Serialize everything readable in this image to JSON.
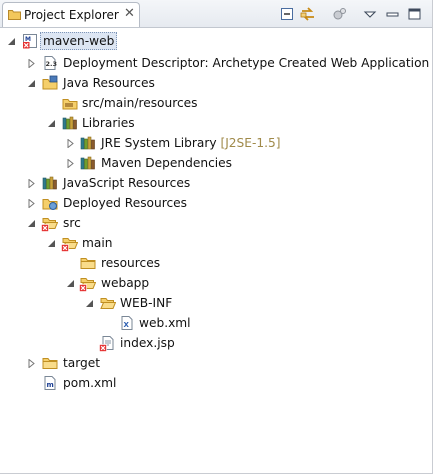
{
  "view": {
    "title": "Project Explorer",
    "close_glyph": "✕"
  },
  "toolbar": {
    "collapse_all_icon": "collapse-all-icon",
    "link_editor_icon": "link-with-editor-icon",
    "view_menu_icon": "view-menu-icon",
    "minimize_icon": "minimize-icon",
    "maximize_icon": "maximize-icon"
  },
  "tree": {
    "project": "maven-web",
    "deployment_descriptor": "Deployment Descriptor: Archetype Created Web Application",
    "java_resources": "Java Resources",
    "src_main_resources": "src/main/resources",
    "libraries": "Libraries",
    "jre_library": "JRE System Library",
    "jre_decoration": "[J2SE-1.5]",
    "maven_dependencies": "Maven Dependencies",
    "javascript_resources": "JavaScript Resources",
    "deployed_resources": "Deployed Resources",
    "src": "src",
    "main": "main",
    "resources": "resources",
    "webapp": "webapp",
    "web_inf": "WEB-INF",
    "web_xml": "web.xml",
    "index_jsp": "index.jsp",
    "target": "target",
    "pom_xml": "pom.xml"
  },
  "colors": {
    "selection": "#dde6f3",
    "folder": "#e8b84a",
    "error": "#d92b2b",
    "decoration": "#a08a4a"
  }
}
